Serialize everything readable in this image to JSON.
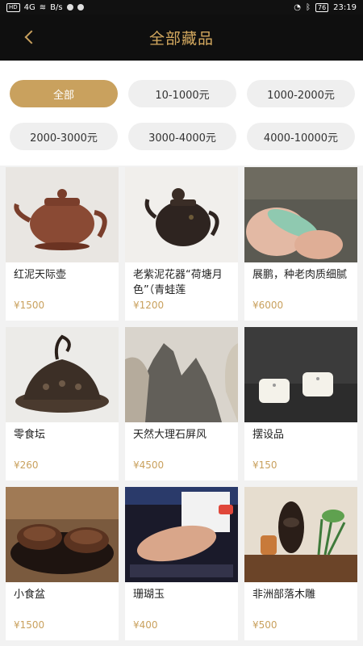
{
  "status_bar": {
    "network": "HD",
    "signal": "4G",
    "speed": "B/s",
    "battery": "76",
    "time": "23:19"
  },
  "header": {
    "title": "全部藏品",
    "back_icon": "chevron-left-icon"
  },
  "filters": [
    {
      "label": "全部",
      "active": true
    },
    {
      "label": "10-1000元",
      "active": false
    },
    {
      "label": "1000-2000元",
      "active": false
    },
    {
      "label": "2000-3000元",
      "active": false
    },
    {
      "label": "3000-4000元",
      "active": false
    },
    {
      "label": "4000-10000元",
      "active": false
    }
  ],
  "colors": {
    "accent": "#c9a15e",
    "header_bg": "#0f0f0f",
    "chip_bg": "#efefef"
  },
  "items": [
    {
      "name": "红泥天际壶",
      "price": "¥1500"
    },
    {
      "name": "老紫泥花器“荷塘月色”（青蛙莲",
      "price": "¥1200"
    },
    {
      "name": "展鹏，种老肉质细腻",
      "price": "¥6000"
    },
    {
      "name": "零食坛",
      "price": "¥260"
    },
    {
      "name": "天然大理石屏风",
      "price": "¥4500"
    },
    {
      "name": "摆设品",
      "price": "¥150"
    },
    {
      "name": "小食盆",
      "price": "¥1500"
    },
    {
      "name": "珊瑚玉",
      "price": "¥400"
    },
    {
      "name": "非洲部落木雕",
      "price": "¥500"
    }
  ]
}
